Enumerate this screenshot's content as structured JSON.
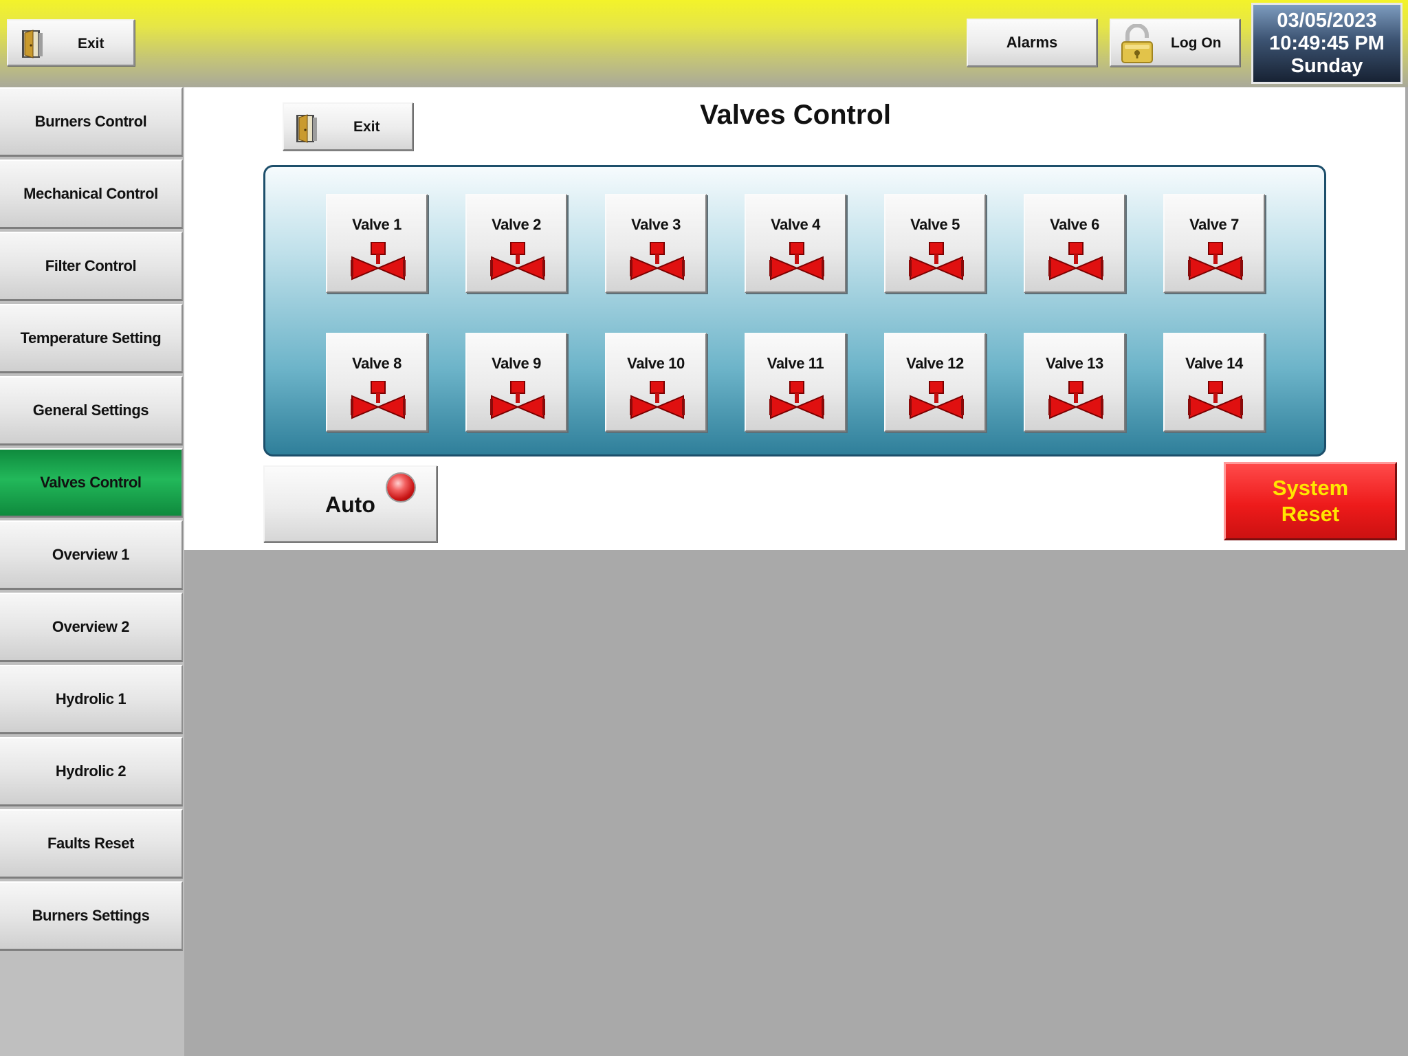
{
  "header": {
    "exit_label": "Exit",
    "alarms_label": "Alarms",
    "logon_label": "Log On",
    "date": "03/05/2023",
    "time": "10:49:45 PM",
    "day": "Sunday"
  },
  "sidebar": {
    "items": [
      {
        "label": "Burners Control"
      },
      {
        "label": "Mechanical Control"
      },
      {
        "label": "Filter Control"
      },
      {
        "label": "Temperature Setting"
      },
      {
        "label": "General Settings"
      },
      {
        "label": "Valves Control",
        "active": true
      },
      {
        "label": "Overview 1"
      },
      {
        "label": "Overview 2"
      },
      {
        "label": "Hydrolic 1"
      },
      {
        "label": "Hydrolic 2"
      },
      {
        "label": "Faults Reset"
      },
      {
        "label": "Burners Settings"
      }
    ]
  },
  "main": {
    "title": "Valves Control",
    "exit_label": "Exit",
    "valves": [
      "Valve 1",
      "Valve 2",
      "Valve 3",
      "Valve 4",
      "Valve 5",
      "Valve 6",
      "Valve 7",
      "Valve 8",
      "Valve 9",
      "Valve 10",
      "Valve 11",
      "Valve 12",
      "Valve 13",
      "Valve 14"
    ],
    "auto_label": "Auto",
    "system_reset_line1": "System",
    "system_reset_line2": "Reset"
  },
  "colors": {
    "active_nav": "#22b85a",
    "valve_red": "#e01010",
    "system_reset_red": "#ee1b1b",
    "system_reset_text": "#ffe600",
    "header_yellow": "#f3f32a"
  },
  "icons": {
    "exit": "door-exit-icon",
    "lock": "padlock-icon",
    "valve": "valve-icon",
    "auto_status": "led-indicator-icon"
  }
}
